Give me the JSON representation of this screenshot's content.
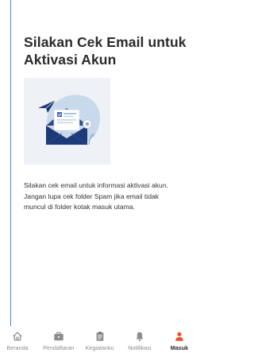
{
  "page": {
    "title": "Silakan Cek Email untuk Aktivasi Akun",
    "message": "Silakan cek email untuk  informasi aktivasi akun.\nJangan lupa cek folder Spam jika email tidak\nmuncul di folder kotak masuk utama."
  },
  "illustration": {
    "icon": "email-envelope-illustration"
  },
  "bottom_nav": {
    "items": [
      {
        "label": "Beranda",
        "icon": "home-icon",
        "active": false
      },
      {
        "label": "Pendaftaran",
        "icon": "briefcase-icon",
        "active": false
      },
      {
        "label": "Kegiatanku",
        "icon": "clipboard-icon",
        "active": false
      },
      {
        "label": "Notifikasi",
        "icon": "bell-icon",
        "active": false
      },
      {
        "label": "Masuk",
        "icon": "user-icon",
        "active": true
      }
    ]
  },
  "colors": {
    "accent": "#e9562c",
    "inactive": "#8c8c8c",
    "text": "#2a2a2a",
    "rule": "#3b8dd8"
  }
}
